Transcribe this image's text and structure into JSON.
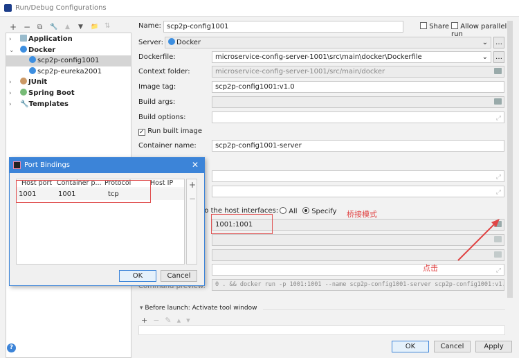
{
  "window": {
    "title": "Run/Debug Configurations"
  },
  "toolbar": [
    "+",
    "−",
    "⧉",
    "🔧",
    "▲",
    "▼",
    "📁",
    "⇅"
  ],
  "tree": [
    {
      "label": "Application",
      "bold": true,
      "expanded": false
    },
    {
      "label": "Docker",
      "bold": true,
      "expanded": true
    },
    {
      "label": "scp2p-config1001",
      "selected": true
    },
    {
      "label": "scp2p-eureka2001"
    },
    {
      "label": "JUnit",
      "bold": true,
      "expanded": false
    },
    {
      "label": "Spring Boot",
      "bold": true,
      "expanded": false
    },
    {
      "label": "Templates",
      "bold": true,
      "expanded": false
    }
  ],
  "form": {
    "name_label": "Name:",
    "name_value": "scp2p-config1001",
    "share_label": "Share",
    "parallel_label": "Allow parallel run",
    "server_label": "Server:",
    "server_value": "Docker",
    "dockerfile_label": "Dockerfile:",
    "dockerfile_value": "microservice-config-server-1001\\src\\main\\docker\\Dockerfile",
    "context_label": "Context folder:",
    "context_value": "microservice-config-server-1001/src/main/docker",
    "image_tag_label": "Image tag:",
    "image_tag_value": "scp2p-config1001:v1.0",
    "build_args_label": "Build args:",
    "build_options_label": "Build options:",
    "run_built_label": "Run built image",
    "container_name_label": "Container name:",
    "container_name_value": "scp2p-config1001-server",
    "bind_label": "s to the host interfaces:",
    "radio_all": "All",
    "radio_specify": "Specify",
    "ports_value": "1001:1001",
    "command_preview_label": "Command preview:",
    "command_preview_value": "0 . && docker run -p 1001:1001 --name scp2p-config1001-server scp2p-config1001:v1.0",
    "before_launch": "Before launch: Activate tool window"
  },
  "buttons": {
    "ok": "OK",
    "cancel": "Cancel",
    "apply": "Apply",
    "help": "?"
  },
  "popup": {
    "title": "Port Bindings",
    "columns": [
      "Host port",
      "Container p...",
      "Protocol",
      "Host IP"
    ],
    "rows": [
      [
        "1001",
        "1001",
        "tcp",
        ""
      ]
    ],
    "ok": "OK",
    "cancel": "Cancel",
    "add": "+",
    "remove": "−"
  },
  "annotations": {
    "bridge": "桥接模式",
    "click": "点击",
    "color": "#e04545"
  }
}
